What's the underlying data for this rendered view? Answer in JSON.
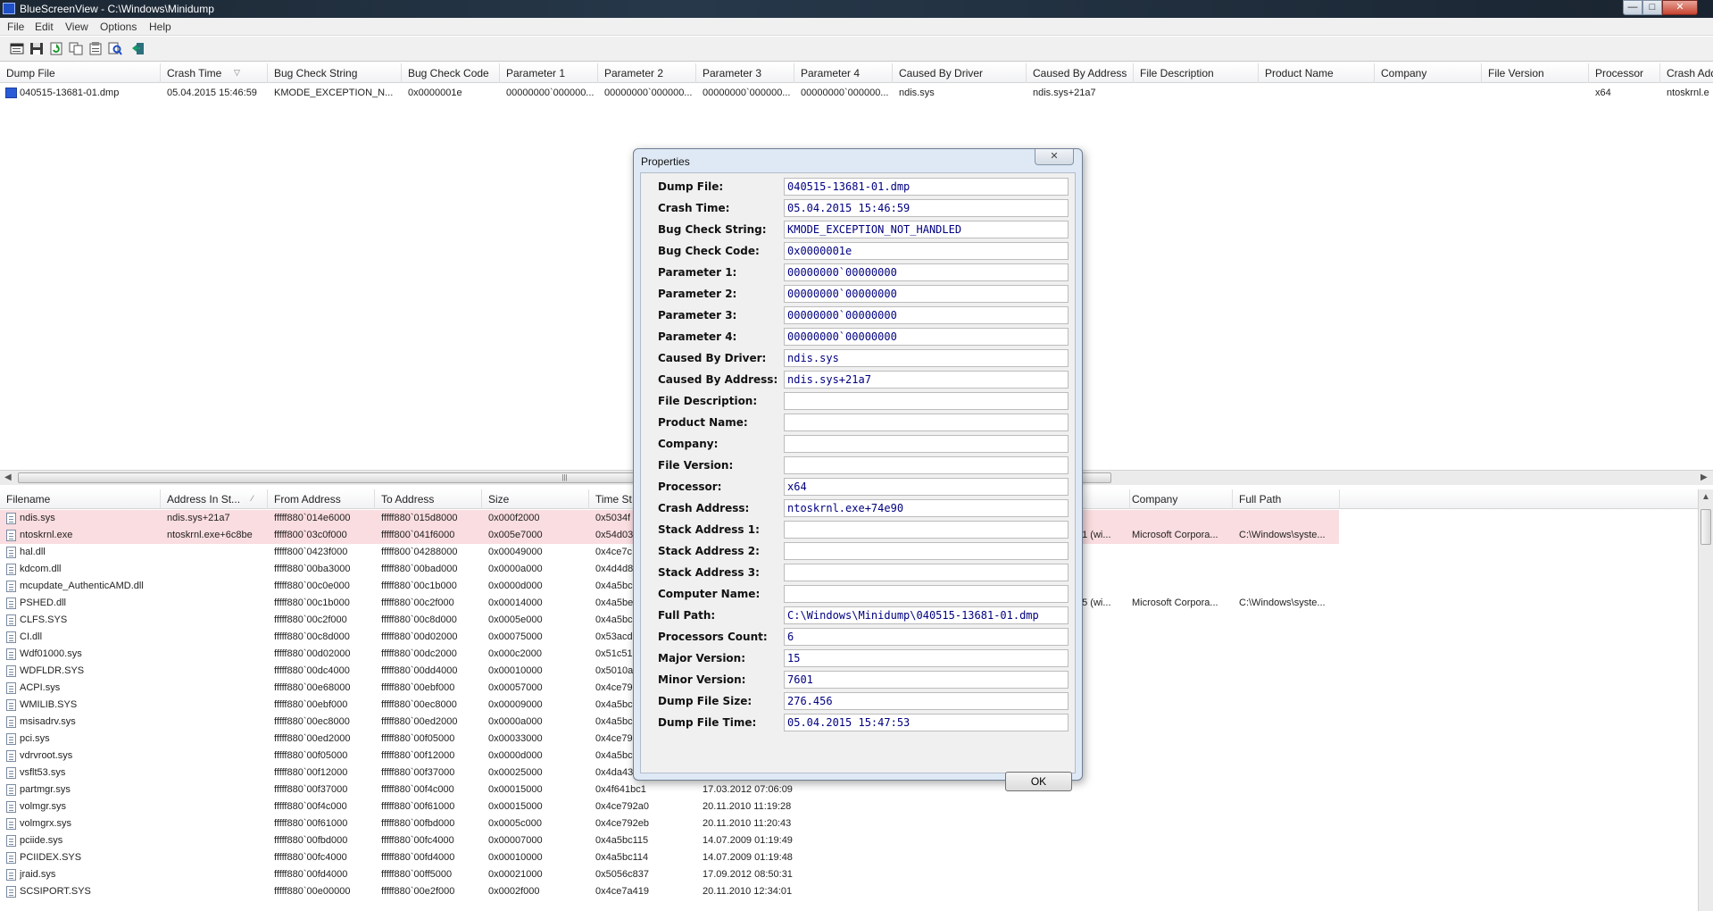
{
  "window": {
    "title": "BlueScreenView  -  C:\\Windows\\Minidump"
  },
  "menu": [
    "File",
    "Edit",
    "View",
    "Options",
    "Help"
  ],
  "toolbar_icons": [
    "properties-icon",
    "save-icon",
    "refresh-icon",
    "copy-icon",
    "html-report-icon",
    "find-icon",
    "exit-icon"
  ],
  "upper_table": {
    "columns": [
      "Dump File",
      "Crash Time",
      "Bug Check String",
      "Bug Check Code",
      "Parameter 1",
      "Parameter 2",
      "Parameter 3",
      "Parameter 4",
      "Caused By Driver",
      "Caused By Address",
      "File Description",
      "Product Name",
      "Company",
      "File Version",
      "Processor",
      "Crash Address"
    ],
    "rows": [
      [
        "040515-13681-01.dmp",
        "05.04.2015 15:46:59",
        "KMODE_EXCEPTION_N...",
        "0x0000001e",
        "00000000`000000...",
        "00000000`000000...",
        "00000000`000000...",
        "00000000`000000...",
        "ndis.sys",
        "ndis.sys+21a7",
        "",
        "",
        "",
        "",
        "x64",
        "ntoskrnl.e"
      ]
    ]
  },
  "lower_table": {
    "columns": [
      "Filename",
      "Address In St...",
      "From Address",
      "To Address",
      "Size",
      "Time St",
      "",
      "Company",
      "Full Path"
    ],
    "rows": [
      {
        "file": "ndis.sys",
        "addr": "ndis.sys+21a7",
        "from": "fffff880`014e6000",
        "to": "fffff880`015d8000",
        "size": "0x000f2000",
        "ts": "0x5034f",
        "date": "",
        "partial": "",
        "company": "",
        "path": "",
        "highlight": true
      },
      {
        "file": "ntoskrnl.exe",
        "addr": "ntoskrnl.exe+6c8be",
        "from": "fffff800`03c0f000",
        "to": "fffff800`041f6000",
        "size": "0x005e7000",
        "ts": "0x54d03",
        "date": "",
        "partial": "41 (wi...",
        "company": "Microsoft Corpora...",
        "path": "C:\\Windows\\syste...",
        "highlight": true
      },
      {
        "file": "hal.dll",
        "addr": "",
        "from": "fffff800`0423f000",
        "to": "fffff800`04288000",
        "size": "0x00049000",
        "ts": "0x4ce7c",
        "date": "",
        "partial": "",
        "company": "",
        "path": "",
        "highlight": false
      },
      {
        "file": "kdcom.dll",
        "addr": "",
        "from": "fffff880`00ba3000",
        "to": "fffff880`00bad000",
        "size": "0x0000a000",
        "ts": "0x4d4d8",
        "date": "",
        "partial": "",
        "company": "",
        "path": "",
        "highlight": false
      },
      {
        "file": "mcupdate_AuthenticAMD.dll",
        "addr": "",
        "from": "fffff880`00c0e000",
        "to": "fffff880`00c1b000",
        "size": "0x0000d000",
        "ts": "0x4a5bc",
        "date": "",
        "partial": "",
        "company": "",
        "path": "",
        "highlight": false
      },
      {
        "file": "PSHED.dll",
        "addr": "",
        "from": "fffff880`00c1b000",
        "to": "fffff880`00c2f000",
        "size": "0x00014000",
        "ts": "0x4a5be",
        "date": "",
        "partial": "85 (wi...",
        "company": "Microsoft Corpora...",
        "path": "C:\\Windows\\syste...",
        "highlight": false
      },
      {
        "file": "CLFS.SYS",
        "addr": "",
        "from": "fffff880`00c2f000",
        "to": "fffff880`00c8d000",
        "size": "0x0005e000",
        "ts": "0x4a5bc",
        "date": "",
        "partial": "",
        "company": "",
        "path": "",
        "highlight": false
      },
      {
        "file": "CI.dll",
        "addr": "",
        "from": "fffff880`00c8d000",
        "to": "fffff880`00d02000",
        "size": "0x00075000",
        "ts": "0x53acd",
        "date": "",
        "partial": "",
        "company": "",
        "path": "",
        "highlight": false
      },
      {
        "file": "Wdf01000.sys",
        "addr": "",
        "from": "fffff880`00d02000",
        "to": "fffff880`00dc2000",
        "size": "0x000c2000",
        "ts": "0x51c51",
        "date": "",
        "partial": "",
        "company": "",
        "path": "",
        "highlight": false
      },
      {
        "file": "WDFLDR.SYS",
        "addr": "",
        "from": "fffff880`00dc4000",
        "to": "fffff880`00dd4000",
        "size": "0x00010000",
        "ts": "0x5010a",
        "date": "",
        "partial": "",
        "company": "",
        "path": "",
        "highlight": false
      },
      {
        "file": "ACPI.sys",
        "addr": "",
        "from": "fffff880`00e68000",
        "to": "fffff880`00ebf000",
        "size": "0x00057000",
        "ts": "0x4ce79",
        "date": "",
        "partial": "",
        "company": "",
        "path": "",
        "highlight": false
      },
      {
        "file": "WMILIB.SYS",
        "addr": "",
        "from": "fffff880`00ebf000",
        "to": "fffff880`00ec8000",
        "size": "0x00009000",
        "ts": "0x4a5bc",
        "date": "",
        "partial": "",
        "company": "",
        "path": "",
        "highlight": false
      },
      {
        "file": "msisadrv.sys",
        "addr": "",
        "from": "fffff880`00ec8000",
        "to": "fffff880`00ed2000",
        "size": "0x0000a000",
        "ts": "0x4a5bc",
        "date": "",
        "partial": "",
        "company": "",
        "path": "",
        "highlight": false
      },
      {
        "file": "pci.sys",
        "addr": "",
        "from": "fffff880`00ed2000",
        "to": "fffff880`00f05000",
        "size": "0x00033000",
        "ts": "0x4ce79",
        "date": "",
        "partial": "",
        "company": "",
        "path": "",
        "highlight": false
      },
      {
        "file": "vdrvroot.sys",
        "addr": "",
        "from": "fffff880`00f05000",
        "to": "fffff880`00f12000",
        "size": "0x0000d000",
        "ts": "0x4a5bc",
        "date": "",
        "partial": "",
        "company": "",
        "path": "",
        "highlight": false
      },
      {
        "file": "vsflt53.sys",
        "addr": "",
        "from": "fffff880`00f12000",
        "to": "fffff880`00f37000",
        "size": "0x00025000",
        "ts": "0x4da43",
        "date": "",
        "partial": "",
        "company": "",
        "path": "",
        "highlight": false
      },
      {
        "file": "partmgr.sys",
        "addr": "",
        "from": "fffff880`00f37000",
        "to": "fffff880`00f4c000",
        "size": "0x00015000",
        "ts": "0x4f641bc1",
        "date": "17.03.2012 07:06:09",
        "partial": "",
        "company": "",
        "path": "",
        "highlight": false
      },
      {
        "file": "volmgr.sys",
        "addr": "",
        "from": "fffff880`00f4c000",
        "to": "fffff880`00f61000",
        "size": "0x00015000",
        "ts": "0x4ce792a0",
        "date": "20.11.2010 11:19:28",
        "partial": "",
        "company": "",
        "path": "",
        "highlight": false
      },
      {
        "file": "volmgrx.sys",
        "addr": "",
        "from": "fffff880`00f61000",
        "to": "fffff880`00fbd000",
        "size": "0x0005c000",
        "ts": "0x4ce792eb",
        "date": "20.11.2010 11:20:43",
        "partial": "",
        "company": "",
        "path": "",
        "highlight": false
      },
      {
        "file": "pciide.sys",
        "addr": "",
        "from": "fffff880`00fbd000",
        "to": "fffff880`00fc4000",
        "size": "0x00007000",
        "ts": "0x4a5bc115",
        "date": "14.07.2009 01:19:49",
        "partial": "",
        "company": "",
        "path": "",
        "highlight": false
      },
      {
        "file": "PCIIDEX.SYS",
        "addr": "",
        "from": "fffff880`00fc4000",
        "to": "fffff880`00fd4000",
        "size": "0x00010000",
        "ts": "0x4a5bc114",
        "date": "14.07.2009 01:19:48",
        "partial": "",
        "company": "",
        "path": "",
        "highlight": false
      },
      {
        "file": "jraid.sys",
        "addr": "",
        "from": "fffff880`00fd4000",
        "to": "fffff880`00ff5000",
        "size": "0x00021000",
        "ts": "0x5056c837",
        "date": "17.09.2012 08:50:31",
        "partial": "",
        "company": "",
        "path": "",
        "highlight": false
      },
      {
        "file": "SCSIPORT.SYS",
        "addr": "",
        "from": "fffff880`00e00000",
        "to": "fffff880`00e2f000",
        "size": "0x0002f000",
        "ts": "0x4ce7a419",
        "date": "20.11.2010 12:34:01",
        "partial": "",
        "company": "",
        "path": "",
        "highlight": false
      }
    ]
  },
  "dialog": {
    "title": "Properties",
    "close_glyph": "✕",
    "ok_label": "OK",
    "fields": [
      {
        "label": "Dump File:",
        "value": "040515-13681-01.dmp"
      },
      {
        "label": "Crash Time:",
        "value": "05.04.2015 15:46:59"
      },
      {
        "label": "Bug Check String:",
        "value": "KMODE_EXCEPTION_NOT_HANDLED"
      },
      {
        "label": "Bug Check Code:",
        "value": "0x0000001e"
      },
      {
        "label": "Parameter 1:",
        "value": "00000000`00000000"
      },
      {
        "label": "Parameter 2:",
        "value": "00000000`00000000"
      },
      {
        "label": "Parameter 3:",
        "value": "00000000`00000000"
      },
      {
        "label": "Parameter 4:",
        "value": "00000000`00000000"
      },
      {
        "label": "Caused By Driver:",
        "value": "ndis.sys"
      },
      {
        "label": "Caused By Address:",
        "value": "ndis.sys+21a7"
      },
      {
        "label": "File Description:",
        "value": ""
      },
      {
        "label": "Product Name:",
        "value": ""
      },
      {
        "label": "Company:",
        "value": ""
      },
      {
        "label": "File Version:",
        "value": ""
      },
      {
        "label": "Processor:",
        "value": "x64"
      },
      {
        "label": "Crash Address:",
        "value": "ntoskrnl.exe+74e90"
      },
      {
        "label": "Stack Address 1:",
        "value": ""
      },
      {
        "label": "Stack Address 2:",
        "value": ""
      },
      {
        "label": "Stack Address 3:",
        "value": ""
      },
      {
        "label": "Computer Name:",
        "value": ""
      },
      {
        "label": "Full Path:",
        "value": "C:\\Windows\\Minidump\\040515-13681-01.dmp"
      },
      {
        "label": "Processors Count:",
        "value": "6"
      },
      {
        "label": "Major Version:",
        "value": "15"
      },
      {
        "label": "Minor Version:",
        "value": "7601"
      },
      {
        "label": "Dump File Size:",
        "value": "276.456"
      },
      {
        "label": "Dump File Time:",
        "value": "05.04.2015 15:47:53"
      }
    ]
  },
  "colors": {
    "highlight_row": "#fadde0",
    "value_text": "#000080",
    "dialog_frame": "#dfe9f5"
  }
}
